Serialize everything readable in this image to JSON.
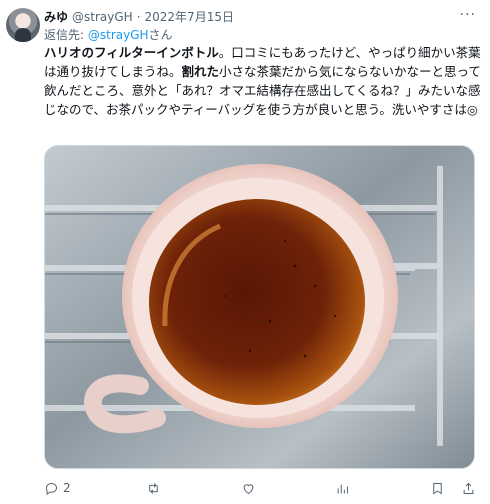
{
  "tweet": {
    "author_name": "みゆ",
    "author_handle": "@strayGH",
    "separator": "·",
    "date": "2022年7月15日",
    "reply_prefix": "返信先: ",
    "reply_mention": "@strayGH",
    "reply_suffix": "さん",
    "text_part1": "ハリオのフィルターインボトル",
    "text_part2": "。口コミにもあったけど、やっぱり細かい茶葉は通り抜けてしまうね。",
    "text_part3": "割れた",
    "text_part4": "小さな茶葉だから気にならないかなーと思って飲んだところ、意外と「あれ？オマエ結構存在感出してくるね？」みたいな感じなので、お茶パックやティーバッグを使う方が良いと思う。洗いやすさは◎",
    "more_label": "···",
    "media_alt": "pink mug of tea on a stainless sink rack"
  },
  "actions": {
    "reply_count": "2",
    "retweet_count": "",
    "like_count": "",
    "views_count": ""
  },
  "colors": {
    "accent": "#1d9bf0",
    "secondary_text": "#536471",
    "primary_text": "#0f1419"
  }
}
